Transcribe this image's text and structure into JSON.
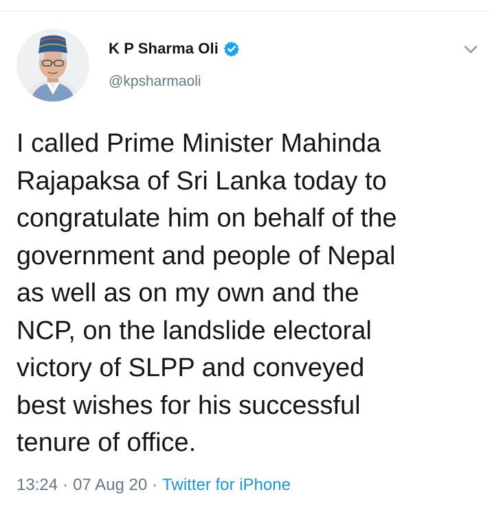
{
  "author": {
    "display_name": "K P Sharma Oli",
    "handle": "@kpsharmaoli",
    "verified": true,
    "verified_icon": "verified-badge-icon",
    "avatar": "profile-photo"
  },
  "tweet": {
    "text": "I called Prime Minister Mahinda\nRajapaksa of Sri Lanka today to\ncongratulate him on behalf of the\ngovernment and people of Nepal\nas well as on my own and the\nNCP, on the landslide electoral\nvictory of SLPP and conveyed\nbest wishes for his successful\ntenure of office.",
    "time": "13:24",
    "date": "07 Aug 20",
    "separator": "·",
    "source": "Twitter for iPhone"
  },
  "menu": {
    "icon": "chevron-down-icon"
  },
  "colors": {
    "text": "#14171a",
    "secondary": "#657786",
    "link": "#1b95e0",
    "verified": "#1da1f2",
    "divider": "#e6ecf0"
  }
}
